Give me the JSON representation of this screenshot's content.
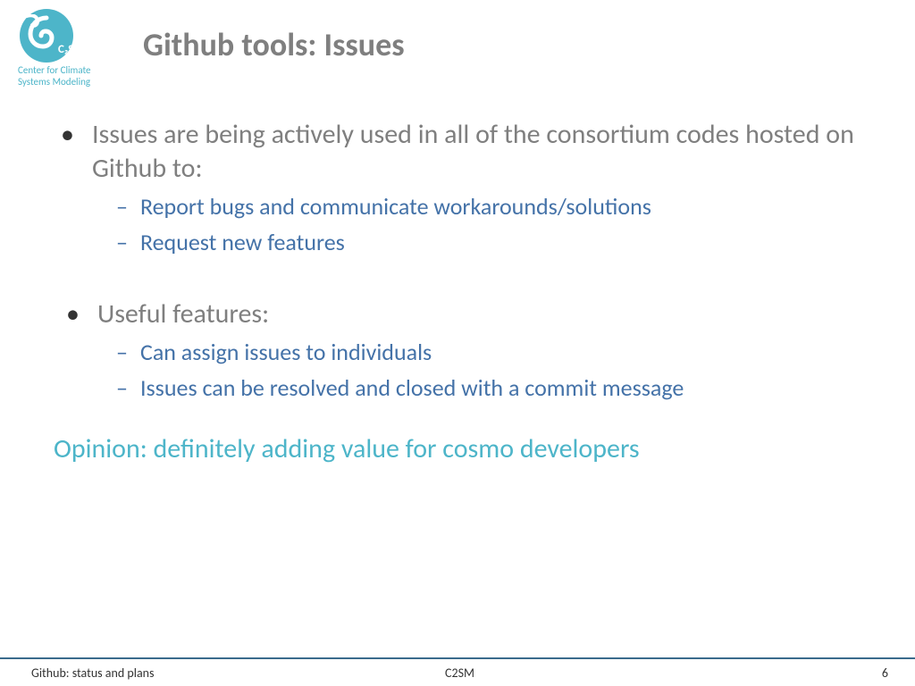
{
  "logo": {
    "label": "C₂SM",
    "subtitle_line1": "Center for Climate",
    "subtitle_line2": "Systems Modeling"
  },
  "title": "Github tools: Issues",
  "bullets": [
    {
      "text": "Issues are being actively used in all of the consortium codes hosted on Github to:",
      "subs": [
        "Report bugs and communicate workarounds/solutions",
        "Request new features"
      ]
    },
    {
      "text": "Useful features:",
      "subs": [
        "Can assign issues to individuals",
        "Issues can be resolved and closed with a commit message"
      ]
    }
  ],
  "opinion": "Opinion: definitely adding value for cosmo developers",
  "footer": {
    "left": "Github: status and plans",
    "center": "C2SM",
    "right": "6"
  }
}
